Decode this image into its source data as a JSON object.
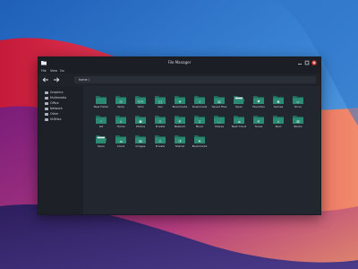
{
  "window": {
    "title": "File Manager"
  },
  "menu": [
    "File",
    "View",
    "Go"
  ],
  "path": "home /",
  "colors": {
    "folder": "#2a8b72",
    "folder_dark": "#1f6d59",
    "accent": "#2a8b72"
  },
  "sidebar": {
    "items": [
      {
        "label": "Graphics",
        "icon": "graphics-icon"
      },
      {
        "label": "Multimedia",
        "icon": "multimedia-icon"
      },
      {
        "label": "Office",
        "icon": "office-icon"
      },
      {
        "label": "Network",
        "icon": "network-icon"
      },
      {
        "label": "Other",
        "icon": "other-icon"
      },
      {
        "label": "Utilities",
        "icon": "utilities-icon"
      }
    ]
  },
  "folders": [
    {
      "label": "New Folder",
      "glyph": ""
    },
    {
      "label": "Temp",
      "glyph": "◷"
    },
    {
      "label": "html",
      "glyph": "</>"
    },
    {
      "label": "dev",
      "glyph": "{}"
    },
    {
      "label": "Bookmarks",
      "glyph": "★"
    },
    {
      "label": "Downloads",
      "glyph": "↓"
    },
    {
      "label": "Saved Files",
      "glyph": "▤"
    },
    {
      "label": "Open",
      "glyph": ""
    },
    {
      "label": "Favorites",
      "glyph": "♥"
    },
    {
      "label": "Games",
      "glyph": "◉"
    },
    {
      "label": "Drive",
      "glyph": "▭"
    },
    {
      "label": "Git",
      "glyph": "⑂"
    },
    {
      "label": "Home",
      "glyph": "⌂"
    },
    {
      "label": "Photos",
      "glyph": "▣"
    },
    {
      "label": "Private",
      "glyph": "⚠"
    },
    {
      "label": "Network",
      "glyph": "⊕"
    },
    {
      "label": "Music",
      "glyph": "♫"
    },
    {
      "label": "Shares",
      "glyph": "◡"
    },
    {
      "label": "Next Cloud",
      "glyph": "☁"
    },
    {
      "label": "Tunes",
      "glyph": "⊛"
    },
    {
      "label": "Root",
      "glyph": "⌂"
    },
    {
      "label": "Books",
      "glyph": "▥"
    },
    {
      "label": "Open",
      "glyph": ""
    },
    {
      "label": "Cloud",
      "glyph": "☁"
    },
    {
      "label": "Images",
      "glyph": "▨"
    },
    {
      "label": "Private",
      "glyph": "⚠"
    },
    {
      "label": "Shared",
      "glyph": "◔"
    },
    {
      "label": "Bookmarks",
      "glyph": "★"
    }
  ]
}
